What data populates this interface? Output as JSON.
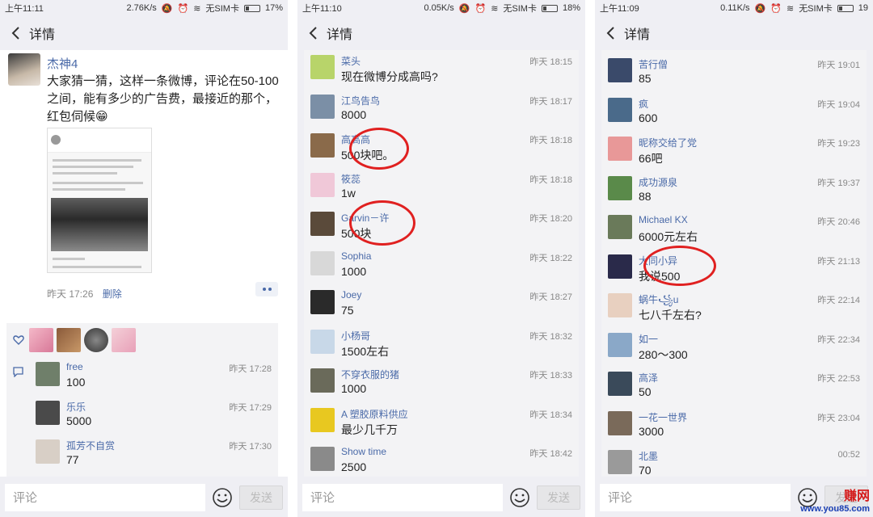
{
  "panels": [
    {
      "status": {
        "time": "上午11:11",
        "speed": "2.76K/s",
        "sim": "无SIM卡",
        "battery": "17%"
      },
      "nav": {
        "title": "详情"
      },
      "post": {
        "user": "杰神4",
        "text": "大家猜一猜，这样一条微博，评论在50-100之间，能有多少的广告费，最接近的那个，红包伺候😁",
        "time": "昨天 17:26",
        "delete_label": "删除"
      },
      "comments": [
        {
          "name": "free",
          "text": "100",
          "time": "昨天 17:28",
          "avatar_color": "#6f7f6a"
        },
        {
          "name": "乐乐",
          "text": "5000",
          "time": "昨天 17:29",
          "avatar_color": "#4a4a4a"
        },
        {
          "name": "孤芳不自赏",
          "text": "77",
          "time": "昨天 17:30",
          "avatar_color": "#d8cfc6"
        }
      ],
      "input": {
        "placeholder": "评论",
        "send_label": "发送"
      }
    },
    {
      "status": {
        "time": "上午11:10",
        "speed": "0.05K/s",
        "sim": "无SIM卡",
        "battery": "18%"
      },
      "nav": {
        "title": "详情"
      },
      "comments": [
        {
          "name": "菜头",
          "text": "现在微博分成高吗?",
          "time": "昨天 18:15",
          "avatar_color": "#b8d46a"
        },
        {
          "name": "江鸟告鸟",
          "text": "8000",
          "time": "昨天 18:17",
          "avatar_color": "#7b8fa6"
        },
        {
          "name": "高高高",
          "text": "500块吧。",
          "time": "昨天 18:18",
          "avatar_color": "#8a6a4a"
        },
        {
          "name": "筱蕊",
          "text": "1w",
          "time": "昨天 18:18",
          "avatar_color": "#f0c8d8"
        },
        {
          "name": "Garvin－许",
          "text": "500块",
          "time": "昨天 18:20",
          "avatar_color": "#5a4a3a"
        },
        {
          "name": "Sophia",
          "text": "1000",
          "time": "昨天 18:22",
          "avatar_color": "#d8d8d8"
        },
        {
          "name": "Joey",
          "text": "75",
          "time": "昨天 18:27",
          "avatar_color": "#2a2a2a"
        },
        {
          "name": "小杨哥",
          "text": "1500左右",
          "time": "昨天 18:32",
          "avatar_color": "#c8d8e8"
        },
        {
          "name": "不穿衣服的猪",
          "text": "1000",
          "time": "昨天 18:33",
          "avatar_color": "#6a6a5a"
        },
        {
          "name": "A 塑胶原料供应",
          "text": "最少几千万",
          "time": "昨天 18:34",
          "avatar_color": "#e8c820"
        },
        {
          "name": "Show time",
          "text": "2500",
          "time": "昨天 18:42",
          "avatar_color": "#8a8a8a"
        }
      ],
      "input": {
        "placeholder": "评论",
        "send_label": "发送"
      }
    },
    {
      "status": {
        "time": "上午11:09",
        "speed": "0.11K/s",
        "sim": "无SIM卡",
        "battery": "19"
      },
      "nav": {
        "title": "详情"
      },
      "comments": [
        {
          "name": "苦行僧",
          "text": "85",
          "time": "昨天 19:01",
          "avatar_color": "#3a4a6a"
        },
        {
          "name": "疯",
          "text": "600",
          "time": "昨天 19:04",
          "avatar_color": "#4a6a8a"
        },
        {
          "name": "昵称交给了党",
          "text": "66吧",
          "time": "昨天 19:23",
          "avatar_color": "#e89898"
        },
        {
          "name": "成功源泉",
          "text": "88",
          "time": "昨天 19:37",
          "avatar_color": "#5a8a4a"
        },
        {
          "name": "Michael KX",
          "text": "6000元左右",
          "time": "昨天 20:46",
          "avatar_color": "#6a7a5a"
        },
        {
          "name": "大同小异",
          "text": "我说500",
          "time": "昨天 21:13",
          "avatar_color": "#2a2a4a"
        },
        {
          "name": "蜗牛꧁u",
          "text": "七八千左右?",
          "time": "昨天 22:14",
          "avatar_color": "#e8d0c0"
        },
        {
          "name": "如一",
          "text": "280～300",
          "time": "昨天 22:34",
          "avatar_color": "#8aa8c8"
        },
        {
          "name": "高泽",
          "text": "50",
          "time": "昨天 22:53",
          "avatar_color": "#3a4a5a"
        },
        {
          "name": "一花一世界",
          "text": "3000",
          "time": "昨天 23:04",
          "avatar_color": "#7a6a5a"
        },
        {
          "name": "北墨",
          "text": "70",
          "time": "00:52",
          "avatar_color": "#9a9a9a"
        }
      ],
      "input": {
        "placeholder": "评论",
        "send_label": "发送"
      }
    }
  ],
  "watermark": {
    "logo": "赚网",
    "url": "www.you85.com"
  }
}
